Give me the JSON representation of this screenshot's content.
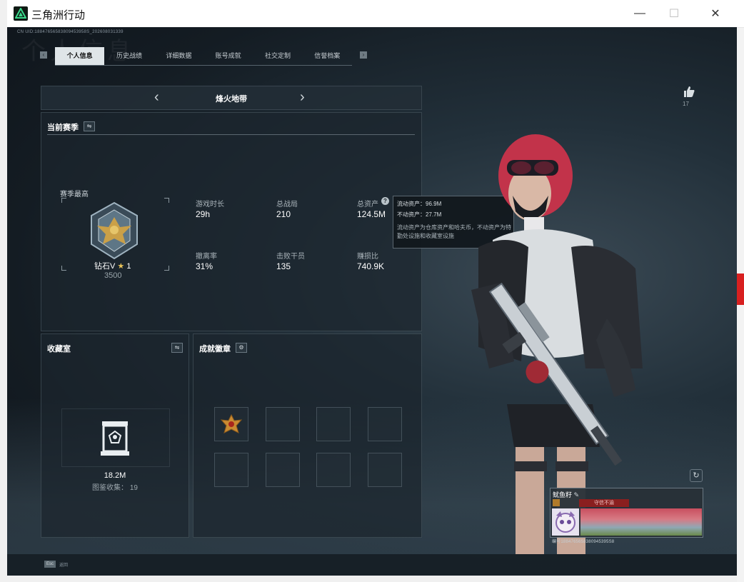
{
  "window": {
    "title": "三角洲行动",
    "minimize": "—",
    "maximize": "☐",
    "close": "✕"
  },
  "header": {
    "uid_line": "CN UID:18847656583809453958S_202608031339",
    "ghost_title": "个人信息"
  },
  "tabs": [
    {
      "label": "个人信息",
      "active": true
    },
    {
      "label": "历史战绩",
      "active": false
    },
    {
      "label": "详细数据",
      "active": false
    },
    {
      "label": "账号成就",
      "active": false
    },
    {
      "label": "社交定制",
      "active": false
    },
    {
      "label": "信誉档案",
      "active": false
    }
  ],
  "mode": {
    "title": "烽火地带",
    "prev": "‹",
    "next": "›"
  },
  "season": {
    "title": "当前赛季",
    "switch_icon": "⇋",
    "best_label": "赛季最高",
    "rank": "钻石V",
    "stars": "1",
    "score": "3500",
    "stats": [
      {
        "label": "游戏时长",
        "value": "29h"
      },
      {
        "label": "总战局",
        "value": "210"
      },
      {
        "label": "总资产",
        "value": "124.5M"
      },
      {
        "label": "撤离率",
        "value": "31%"
      },
      {
        "label": "击败干员",
        "value": "135"
      },
      {
        "label": "赚损比",
        "value": "740.9K"
      }
    ]
  },
  "tooltip": {
    "liquid": "流动资产：96.9M",
    "fixed": "不动资产：27.7M",
    "note": "流动资产为仓库资产和哈夫币，不动资产为特勤处设施和收藏室设施"
  },
  "collection": {
    "title": "收藏室",
    "switch_icon": "⇋",
    "value": "18.2M",
    "catalog_label": "图鉴收集：",
    "catalog_count": "19"
  },
  "badges": {
    "title": "成就徽章",
    "settings_icon": "⚙",
    "slots": 8
  },
  "like": {
    "count": "17"
  },
  "card": {
    "name": "鱿鱼籽",
    "banner": "守信不渝",
    "id": "编号1884765658380945395S8"
  },
  "footer": {
    "esc_key": "Esc",
    "esc_text": "返回"
  },
  "colors": {
    "accent": "#dfe5e8",
    "panel": "#1c262e",
    "banner_red": "#8a1f1f"
  }
}
